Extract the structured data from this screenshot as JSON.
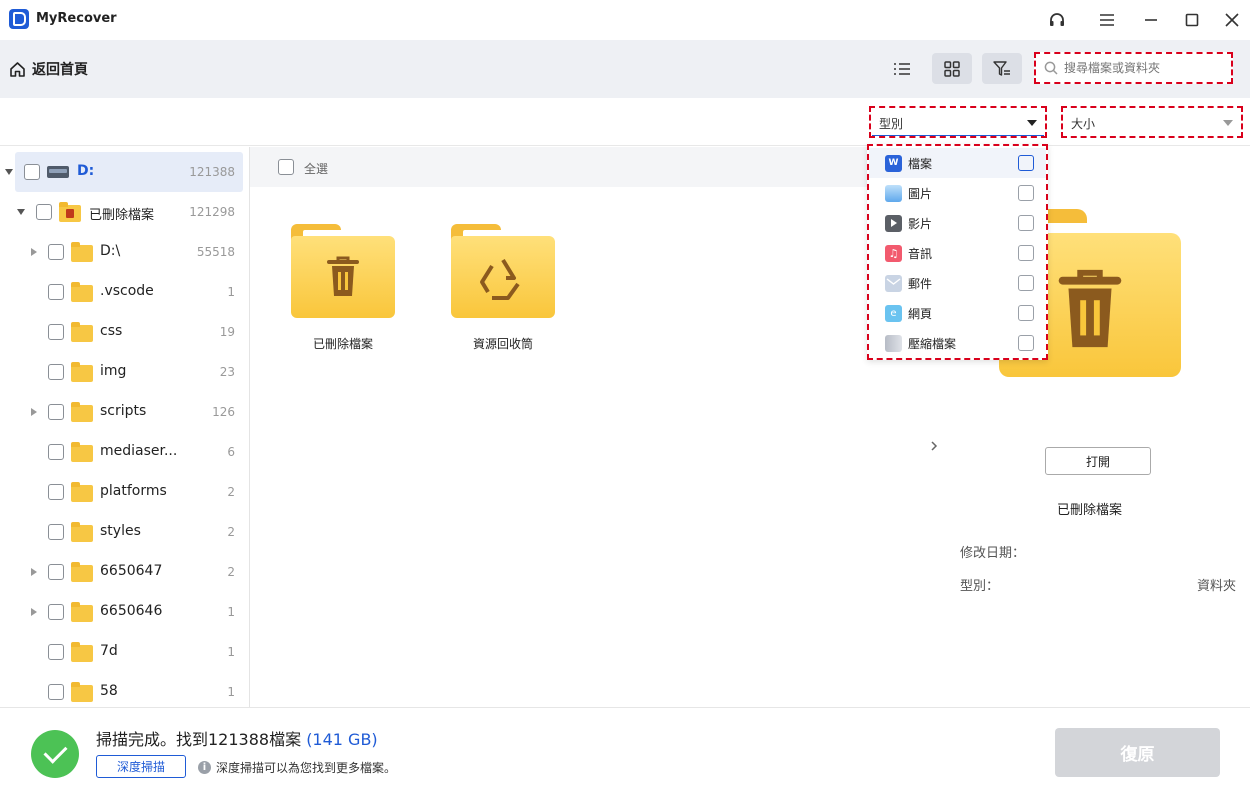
{
  "app": {
    "title": "MyRecover"
  },
  "toolbar": {
    "home_label": "返回首頁",
    "search_placeholder": "搜尋檔案或資料夾"
  },
  "filters": {
    "type_label": "型別",
    "size_label": "大小",
    "type_options": [
      {
        "label": "檔案",
        "icon": "word-doc-icon",
        "checked": false
      },
      {
        "label": "圖片",
        "icon": "image-icon",
        "checked": false
      },
      {
        "label": "影片",
        "icon": "video-icon",
        "checked": false
      },
      {
        "label": "音訊",
        "icon": "music-icon",
        "checked": false
      },
      {
        "label": "郵件",
        "icon": "mail-icon",
        "checked": false
      },
      {
        "label": "網頁",
        "icon": "webpage-icon",
        "checked": false
      },
      {
        "label": "壓縮檔案",
        "icon": "zip-icon",
        "checked": false
      }
    ]
  },
  "tree": [
    {
      "label": "D:",
      "count": "121388",
      "expand": "expanded"
    },
    {
      "label": "已刪除檔案",
      "count": "121298",
      "expand": "expanded"
    },
    {
      "label": "D:\\",
      "count": "55518",
      "expand": "collapsed"
    },
    {
      "label": ".vscode",
      "count": "1",
      "expand": "none"
    },
    {
      "label": "css",
      "count": "19",
      "expand": "none"
    },
    {
      "label": "img",
      "count": "23",
      "expand": "none"
    },
    {
      "label": "scripts",
      "count": "126",
      "expand": "collapsed"
    },
    {
      "label": "mediaser...",
      "count": "6",
      "expand": "none"
    },
    {
      "label": "platforms",
      "count": "2",
      "expand": "none"
    },
    {
      "label": "styles",
      "count": "2",
      "expand": "none"
    },
    {
      "label": "6650647",
      "count": "2",
      "expand": "collapsed"
    },
    {
      "label": "6650646",
      "count": "1",
      "expand": "collapsed"
    },
    {
      "label": "7d",
      "count": "1",
      "expand": "none"
    },
    {
      "label": "58",
      "count": "1",
      "expand": "none"
    }
  ],
  "content": {
    "select_all": "全選",
    "folders": [
      {
        "label": "已刪除檔案",
        "icon": "trash-icon"
      },
      {
        "label": "資源回收筒",
        "icon": "recycle-icon"
      }
    ]
  },
  "details": {
    "open_button": "打開",
    "name": "已刪除檔案",
    "modified_label": "修改日期：",
    "modified_value": "",
    "type_label": "型別：",
    "type_value": "資料夾"
  },
  "status": {
    "scan_done": "掃描完成。找到121388檔案",
    "size": "(141 GB)",
    "deep_scan_button": "深度掃描",
    "deep_scan_hint": "深度掃描可以為您找到更多檔案。",
    "recover_button": "復原"
  },
  "colors": {
    "accent": "#1f5bd6",
    "success": "#4cc255",
    "highlight_dashed": "#d9001b"
  }
}
